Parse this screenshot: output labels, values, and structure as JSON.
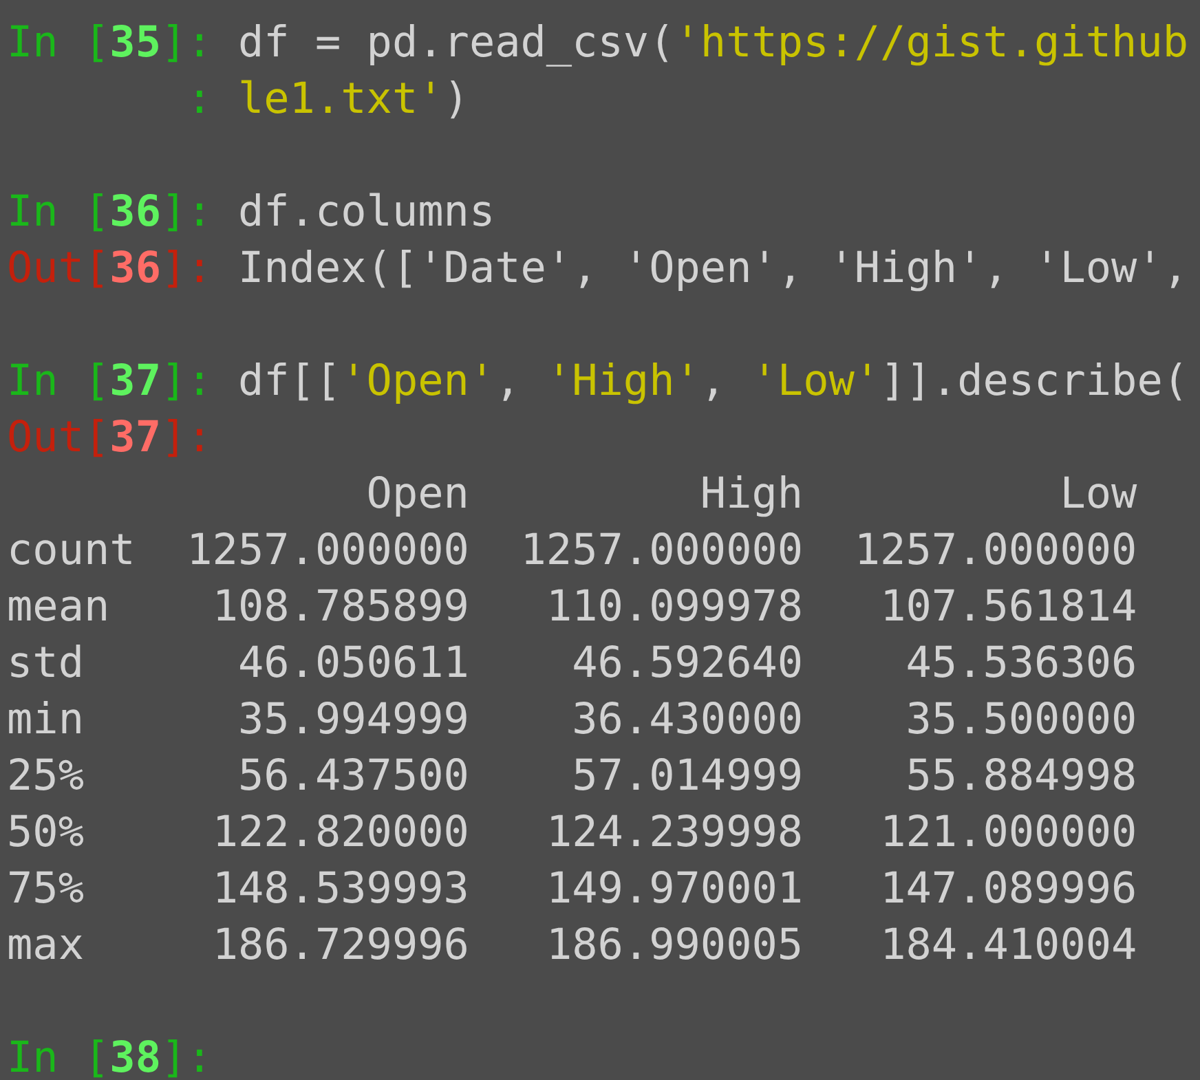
{
  "cells": [
    {
      "kind": "input",
      "prompt": "In [**35**]:",
      "lines": [
        {
          "tokens": [
            {
              "kind": "code",
              "text": "df = pd.read_csv("
            },
            {
              "kind": "string",
              "text": "'https://gist.github"
            }
          ]
        },
        {
          "continuation": ":",
          "tokens": [
            {
              "kind": "string",
              "text": "le1.txt'"
            },
            {
              "kind": "code",
              "text": ")"
            }
          ]
        }
      ]
    },
    {
      "kind": "input",
      "prompt": "In [**36**]:",
      "lines": [
        {
          "tokens": [
            {
              "kind": "code",
              "text": "df.columns"
            }
          ]
        }
      ]
    },
    {
      "kind": "output",
      "prompt": "Out[**36**]:",
      "lines": [
        {
          "tokens": [
            {
              "kind": "code",
              "text": "Index(['Date', 'Open', 'High', 'Low',"
            }
          ]
        }
      ]
    },
    {
      "kind": "input",
      "prompt": "In [**37**]:",
      "lines": [
        {
          "tokens": [
            {
              "kind": "code",
              "text": "df[["
            },
            {
              "kind": "string",
              "text": "'Open'"
            },
            {
              "kind": "code",
              "text": ", "
            },
            {
              "kind": "string",
              "text": "'High'"
            },
            {
              "kind": "code",
              "text": ", "
            },
            {
              "kind": "string",
              "text": "'Low'"
            },
            {
              "kind": "code",
              "text": "]].describe("
            }
          ]
        }
      ]
    },
    {
      "kind": "output",
      "prompt": "Out[**37**]:",
      "table": {
        "columns": [
          "Open",
          "High",
          "Low"
        ],
        "rows": [
          {
            "index": "count",
            "values": [
              "1257.000000",
              "1257.000000",
              "1257.000000"
            ]
          },
          {
            "index": "mean",
            "values": [
              "108.785899",
              "110.099978",
              "107.561814"
            ]
          },
          {
            "index": "std",
            "values": [
              "46.050611",
              "46.592640",
              "45.536306"
            ]
          },
          {
            "index": "min",
            "values": [
              "35.994999",
              "36.430000",
              "35.500000"
            ]
          },
          {
            "index": "25%",
            "values": [
              "56.437500",
              "57.014999",
              "55.884998"
            ]
          },
          {
            "index": "50%",
            "values": [
              "122.820000",
              "124.239998",
              "121.000000"
            ]
          },
          {
            "index": "75%",
            "values": [
              "148.539993",
              "149.970001",
              "147.089996"
            ]
          },
          {
            "index": "max",
            "values": [
              "186.729996",
              "186.990005",
              "184.410004"
            ]
          }
        ]
      }
    },
    {
      "kind": "input",
      "prompt": "In [**38**]:"
    }
  ]
}
